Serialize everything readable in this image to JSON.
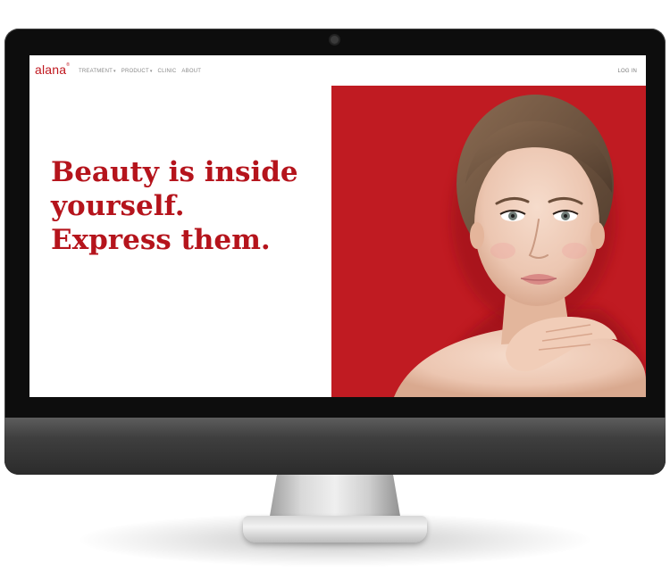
{
  "site": {
    "logo_text": "alana",
    "logo_mark": "®"
  },
  "nav": {
    "items": [
      {
        "label": "TREATMENT",
        "dropdown": true
      },
      {
        "label": "PRODUCT",
        "dropdown": true
      },
      {
        "label": "CLINIC",
        "dropdown": false
      },
      {
        "label": "ABOUT",
        "dropdown": false
      }
    ],
    "login_label": "LOG IN"
  },
  "hero": {
    "headline_lines": [
      "Beauty is inside",
      "yourself.",
      "Express them."
    ],
    "image_subject": "woman-portrait"
  },
  "colors": {
    "brand_red": "#c0181f",
    "hero_bg": "#c01b22",
    "nav_text": "#8a8a8a",
    "bezel": "#0d0d0d"
  }
}
